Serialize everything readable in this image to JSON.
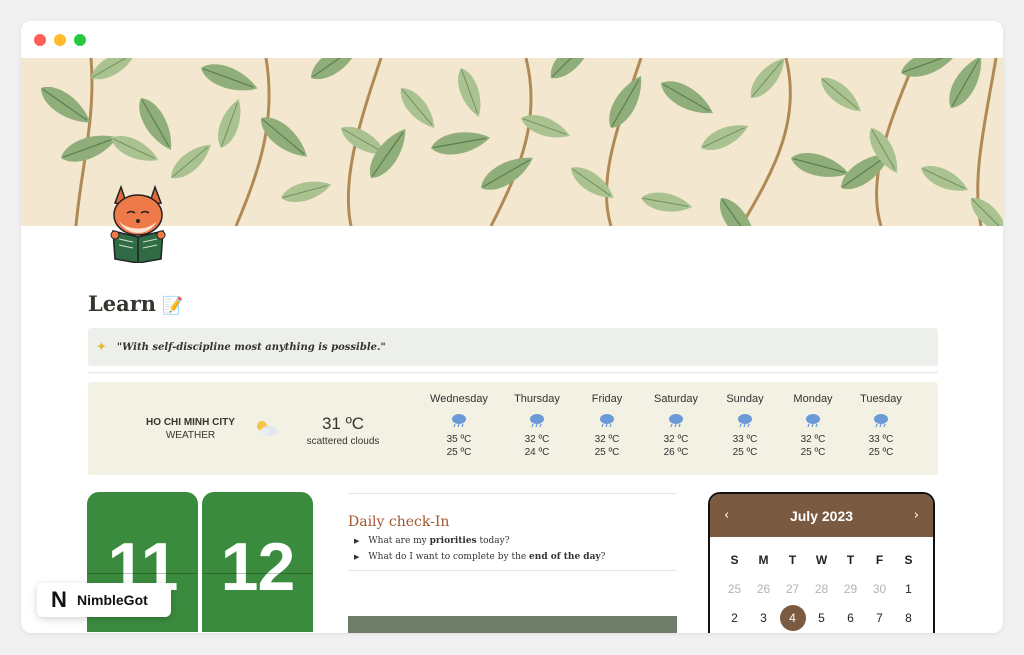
{
  "page": {
    "title": "Learn",
    "title_emoji": "📝",
    "quote_icon": "sparkles-icon",
    "quote": "\"With self-discipline most anything is possible.\""
  },
  "weather": {
    "city": "HO CHI MINH CITY",
    "label": "WEATHER",
    "current_icon": "partly-cloudy-icon",
    "current_temp": "31 ºC",
    "description": "scattered clouds",
    "forecast": [
      {
        "day": "Wednesday",
        "high": "35 ºC",
        "low": "25 ºC",
        "icon": "rain-cloud-icon"
      },
      {
        "day": "Thursday",
        "high": "32 ºC",
        "low": "24 ºC",
        "icon": "rain-cloud-icon"
      },
      {
        "day": "Friday",
        "high": "32 ºC",
        "low": "25 ºC",
        "icon": "rain-cloud-icon"
      },
      {
        "day": "Saturday",
        "high": "32 ºC",
        "low": "26 ºC",
        "icon": "rain-cloud-icon"
      },
      {
        "day": "Sunday",
        "high": "33 ºC",
        "low": "25 ºC",
        "icon": "rain-cloud-icon"
      },
      {
        "day": "Monday",
        "high": "32 ºC",
        "low": "25 ºC",
        "icon": "rain-cloud-icon"
      },
      {
        "day": "Tuesday",
        "high": "33 ºC",
        "low": "25 ºC",
        "icon": "rain-cloud-icon"
      }
    ]
  },
  "clock": {
    "hours": "11",
    "minutes": "12",
    "color": "#3b8b3e"
  },
  "checkin": {
    "heading": "Daily check-In",
    "items": [
      {
        "pre": "What are my ",
        "bold": "priorities",
        "post": " today?"
      },
      {
        "pre": "What do I want to complete by the ",
        "bold": "end of the day",
        "post": "?"
      }
    ]
  },
  "calendar": {
    "month": "July 2023",
    "prev_icon": "chevron-left-icon",
    "next_icon": "chevron-right-icon",
    "accent": "#7b5a42",
    "weekdays": [
      "S",
      "M",
      "T",
      "W",
      "T",
      "F",
      "S"
    ],
    "week1": [
      "25",
      "26",
      "27",
      "28",
      "29",
      "30",
      "1"
    ],
    "week2": [
      "2",
      "3",
      "4",
      "5",
      "6",
      "7",
      "8"
    ],
    "today": "4"
  },
  "badge": {
    "logo": "N",
    "brand": "NimbleGot"
  }
}
